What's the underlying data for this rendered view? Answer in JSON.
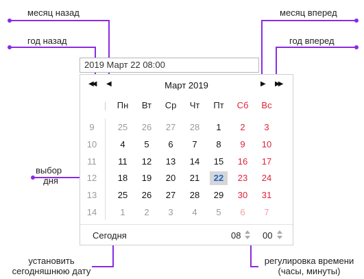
{
  "annotations": {
    "month_back": "месяц назад",
    "month_forward": "месяц вперед",
    "year_back": "год назад",
    "year_forward": "год вперед",
    "select_day_line1": "выбор",
    "select_day_line2": "дня",
    "set_today_line1": "установить",
    "set_today_line2": "сегодняшнюю дату",
    "time_adjust_line1": "регулировка времени",
    "time_adjust_line2": "(часы, минуты)"
  },
  "input": {
    "value": "2019 Март 22 08:00"
  },
  "calendar": {
    "title": "Март 2019",
    "weekday_headers": [
      "Пн",
      "Вт",
      "Ср",
      "Чт",
      "Пт",
      "Сб",
      "Вс"
    ],
    "weeks": [
      "9",
      "10",
      "11",
      "12",
      "13",
      "14"
    ],
    "days": [
      [
        "25",
        "26",
        "27",
        "28",
        "1",
        "2",
        "3"
      ],
      [
        "4",
        "5",
        "6",
        "7",
        "8",
        "9",
        "10"
      ],
      [
        "11",
        "12",
        "13",
        "14",
        "15",
        "16",
        "17"
      ],
      [
        "18",
        "19",
        "20",
        "21",
        "22",
        "23",
        "24"
      ],
      [
        "25",
        "26",
        "27",
        "28",
        "29",
        "30",
        "31"
      ],
      [
        "1",
        "2",
        "3",
        "4",
        "5",
        "6",
        "7"
      ]
    ],
    "today_label": "Сегодня",
    "hours": "08",
    "minutes": "00"
  },
  "colors": {
    "annotation": "#8a2be2",
    "weekend": "#e0223a",
    "today_text": "#1e64c8"
  },
  "icons": {
    "prev_year": "double-chevron-left-icon",
    "prev_month": "chevron-left-icon",
    "next_month": "chevron-right-icon",
    "next_year": "double-chevron-right-icon"
  }
}
